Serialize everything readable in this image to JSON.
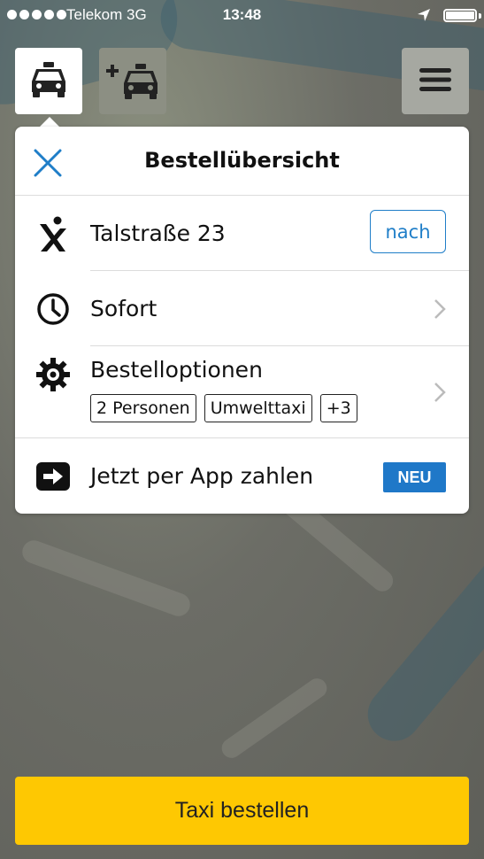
{
  "status_bar": {
    "carrier": "Telekom 3G",
    "time": "13:48",
    "signal_bars": 5
  },
  "top_buttons": {
    "taxi_icon": "taxi-icon",
    "add_taxi_icon": "add-taxi-icon",
    "menu_icon": "hamburger-menu-icon"
  },
  "card": {
    "title": "Bestellübersicht",
    "address": {
      "icon": "pickup-location-icon",
      "label": "Talstraße 23",
      "button_label": "nach"
    },
    "time": {
      "icon": "clock-icon",
      "label": "Sofort"
    },
    "options": {
      "icon": "gear-icon",
      "label": "Bestelloptionen",
      "chips": [
        "2 Personen",
        "Umwelttaxi",
        "+3"
      ]
    },
    "payment": {
      "icon": "arrow-right-icon",
      "label": "Jetzt per App zahlen",
      "badge": "NEU"
    }
  },
  "order_button": "Taxi bestellen",
  "colors": {
    "accent_blue": "#1f7ec8",
    "order_yellow": "#fec802",
    "badge_blue": "#1f78c8"
  }
}
